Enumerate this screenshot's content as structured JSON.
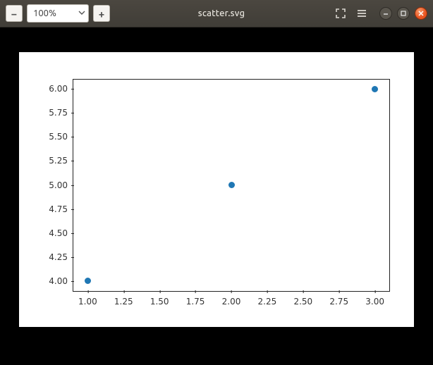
{
  "window": {
    "title": "scatter.svg"
  },
  "toolbar": {
    "zoom_out_label": "−",
    "zoom_in_label": "+",
    "zoom_value": "100%"
  },
  "icons": {
    "chevron_down": "chevron-down-icon",
    "fullscreen": "fullscreen-icon",
    "hamburger": "hamburger-icon",
    "minimize": "minimize-icon",
    "maximize": "maximize-icon",
    "close": "close-icon"
  },
  "chart_data": {
    "type": "scatter",
    "x": [
      1,
      2,
      3
    ],
    "y": [
      4,
      5,
      6
    ],
    "xlim": [
      0.9,
      3.1
    ],
    "ylim": [
      3.9,
      6.1
    ],
    "xticks": [
      "1.00",
      "1.25",
      "1.50",
      "1.75",
      "2.00",
      "2.25",
      "2.50",
      "2.75",
      "3.00"
    ],
    "yticks": [
      "4.00",
      "4.25",
      "4.50",
      "4.75",
      "5.00",
      "5.25",
      "5.50",
      "5.75",
      "6.00"
    ],
    "xtick_vals": [
      1.0,
      1.25,
      1.5,
      1.75,
      2.0,
      2.25,
      2.5,
      2.75,
      3.0
    ],
    "ytick_vals": [
      4.0,
      4.25,
      4.5,
      4.75,
      5.0,
      5.25,
      5.5,
      5.75,
      6.0
    ],
    "marker_color": "#1f77b4"
  }
}
